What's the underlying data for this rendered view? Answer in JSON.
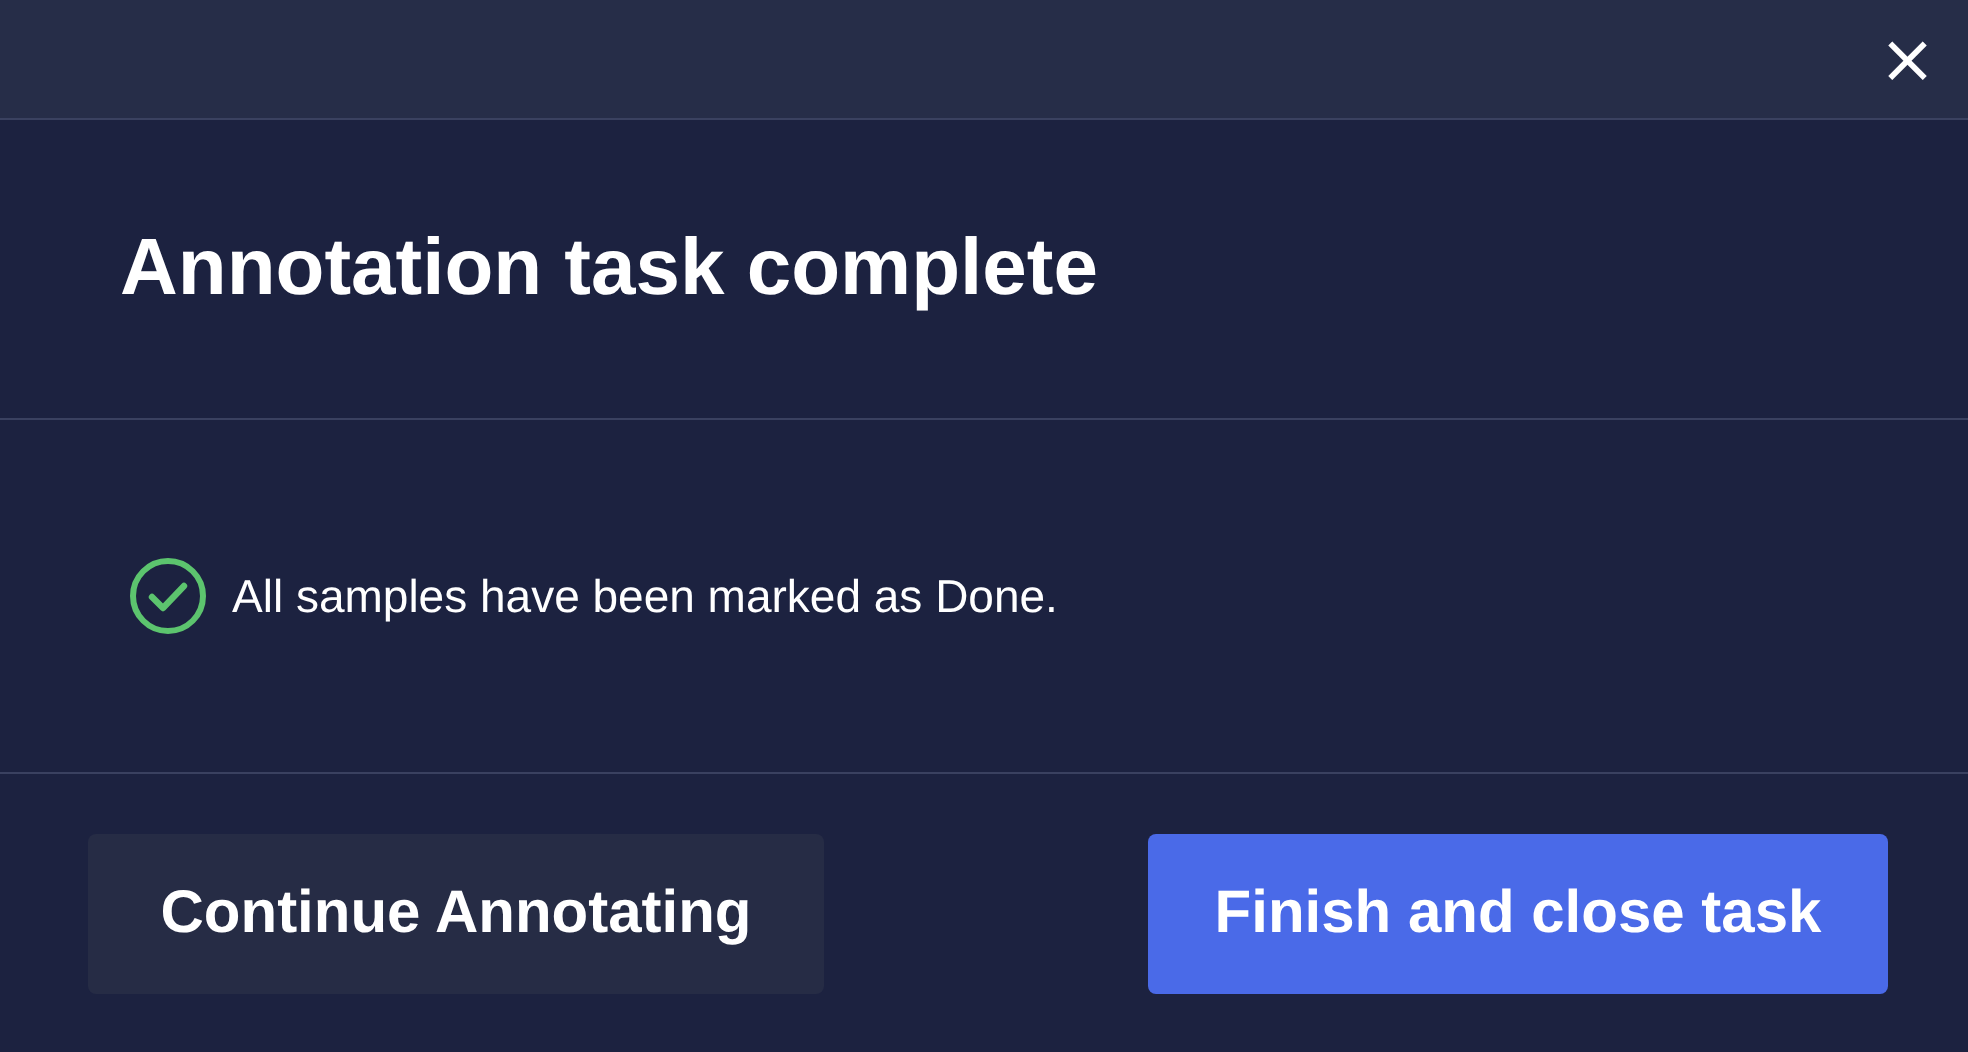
{
  "dialog": {
    "close_label": "×",
    "title": "Annotation task complete",
    "message": "All samples have been marked as Done.",
    "buttons": [
      {
        "label": "Continue Annotating",
        "kind": "secondary"
      },
      {
        "label": "Finish and close task",
        "kind": "primary"
      }
    ]
  }
}
